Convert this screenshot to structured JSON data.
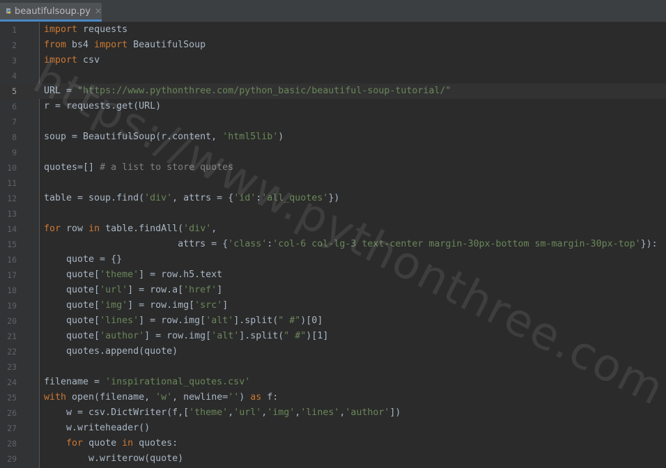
{
  "tab": {
    "filename": "beautifulsoup.py",
    "close_glyph": "✕",
    "file_icon": "python-file-icon"
  },
  "colors": {
    "keyword": "#cc7832",
    "string": "#6a8759",
    "comment": "#808080",
    "identifier": "#a9b7c6",
    "line_number": "#606366",
    "background": "#2b2b2b"
  },
  "watermark": "https://www.pythonthree.com",
  "current_line": 5,
  "lines": [
    {
      "n": "1",
      "tokens": [
        [
          "kw",
          "import"
        ],
        [
          "p",
          " requests"
        ]
      ]
    },
    {
      "n": "2",
      "tokens": [
        [
          "kw",
          "from"
        ],
        [
          "p",
          " bs4 "
        ],
        [
          "kw",
          "import"
        ],
        [
          "p",
          " BeautifulSoup"
        ]
      ]
    },
    {
      "n": "3",
      "tokens": [
        [
          "kw",
          "import"
        ],
        [
          "p",
          " csv"
        ]
      ]
    },
    {
      "n": "4",
      "tokens": []
    },
    {
      "n": "5",
      "tokens": [
        [
          "p",
          "URL = "
        ],
        [
          "str",
          "\"https://www.pythonthree.com/python_basic/beautiful-soup-tutorial/\""
        ]
      ]
    },
    {
      "n": "6",
      "tokens": [
        [
          "p",
          "r = requests.get(URL)"
        ]
      ]
    },
    {
      "n": "7",
      "tokens": []
    },
    {
      "n": "8",
      "tokens": [
        [
          "p",
          "soup = BeautifulSoup(r.content, "
        ],
        [
          "str",
          "'html5lib'"
        ],
        [
          "p",
          ")"
        ]
      ]
    },
    {
      "n": "9",
      "tokens": []
    },
    {
      "n": "10",
      "tokens": [
        [
          "p",
          "quotes=[] "
        ],
        [
          "cmt",
          "# a list to store quotes"
        ]
      ]
    },
    {
      "n": "11",
      "tokens": []
    },
    {
      "n": "12",
      "tokens": [
        [
          "p",
          "table = soup.find("
        ],
        [
          "str",
          "'div'"
        ],
        [
          "p",
          ", attrs = {"
        ],
        [
          "str",
          "'id'"
        ],
        [
          "p",
          ":"
        ],
        [
          "str",
          "'all_quotes'"
        ],
        [
          "p",
          "})"
        ]
      ]
    },
    {
      "n": "13",
      "tokens": []
    },
    {
      "n": "14",
      "tokens": [
        [
          "kw",
          "for"
        ],
        [
          "p",
          " row "
        ],
        [
          "kw",
          "in"
        ],
        [
          "p",
          " table.findAll("
        ],
        [
          "str",
          "'div'"
        ],
        [
          "p",
          ","
        ]
      ]
    },
    {
      "n": "15",
      "tokens": [
        [
          "p",
          "                        attrs = {"
        ],
        [
          "str",
          "'class'"
        ],
        [
          "p",
          ":"
        ],
        [
          "str",
          "'col-6 col-lg-3 text-center margin-30px-bottom sm-margin-30px-top'"
        ],
        [
          "p",
          "}):"
        ]
      ]
    },
    {
      "n": "16",
      "tokens": [
        [
          "p",
          "    quote = {}"
        ]
      ]
    },
    {
      "n": "17",
      "tokens": [
        [
          "p",
          "    quote["
        ],
        [
          "str",
          "'theme'"
        ],
        [
          "p",
          "] = row.h5.text"
        ]
      ]
    },
    {
      "n": "18",
      "tokens": [
        [
          "p",
          "    quote["
        ],
        [
          "str",
          "'url'"
        ],
        [
          "p",
          "] = row.a["
        ],
        [
          "str",
          "'href'"
        ],
        [
          "p",
          "]"
        ]
      ]
    },
    {
      "n": "19",
      "tokens": [
        [
          "p",
          "    quote["
        ],
        [
          "str",
          "'img'"
        ],
        [
          "p",
          "] = row.img["
        ],
        [
          "str",
          "'src'"
        ],
        [
          "p",
          "]"
        ]
      ]
    },
    {
      "n": "20",
      "tokens": [
        [
          "p",
          "    quote["
        ],
        [
          "str",
          "'lines'"
        ],
        [
          "p",
          "] = row.img["
        ],
        [
          "str",
          "'alt'"
        ],
        [
          "p",
          "].split("
        ],
        [
          "str",
          "\" #\""
        ],
        [
          "p",
          ")[0]"
        ]
      ]
    },
    {
      "n": "21",
      "tokens": [
        [
          "p",
          "    quote["
        ],
        [
          "str",
          "'author'"
        ],
        [
          "p",
          "] = row.img["
        ],
        [
          "str",
          "'alt'"
        ],
        [
          "p",
          "].split("
        ],
        [
          "str",
          "\" #\""
        ],
        [
          "p",
          ")[1]"
        ]
      ]
    },
    {
      "n": "22",
      "tokens": [
        [
          "p",
          "    quotes.append(quote)"
        ]
      ]
    },
    {
      "n": "23",
      "tokens": []
    },
    {
      "n": "24",
      "tokens": [
        [
          "p",
          "filename = "
        ],
        [
          "str",
          "'inspirational_quotes.csv'"
        ]
      ]
    },
    {
      "n": "25",
      "tokens": [
        [
          "kw",
          "with"
        ],
        [
          "p",
          " open(filename, "
        ],
        [
          "str",
          "'w'"
        ],
        [
          "p",
          ", newline="
        ],
        [
          "str",
          "''"
        ],
        [
          "p",
          ") "
        ],
        [
          "kw",
          "as"
        ],
        [
          "p",
          " f:"
        ]
      ]
    },
    {
      "n": "26",
      "tokens": [
        [
          "p",
          "    w = csv.DictWriter(f,["
        ],
        [
          "str",
          "'theme'"
        ],
        [
          "p",
          ","
        ],
        [
          "str",
          "'url'"
        ],
        [
          "p",
          ","
        ],
        [
          "str",
          "'img'"
        ],
        [
          "p",
          ","
        ],
        [
          "str",
          "'lines'"
        ],
        [
          "p",
          ","
        ],
        [
          "str",
          "'author'"
        ],
        [
          "p",
          "])"
        ]
      ]
    },
    {
      "n": "27",
      "tokens": [
        [
          "p",
          "    w.writeheader()"
        ]
      ]
    },
    {
      "n": "28",
      "tokens": [
        [
          "p",
          "    "
        ],
        [
          "kw",
          "for"
        ],
        [
          "p",
          " quote "
        ],
        [
          "kw",
          "in"
        ],
        [
          "p",
          " quotes:"
        ]
      ]
    },
    {
      "n": "29",
      "tokens": [
        [
          "p",
          "        w.writerow(quote)"
        ]
      ]
    }
  ]
}
